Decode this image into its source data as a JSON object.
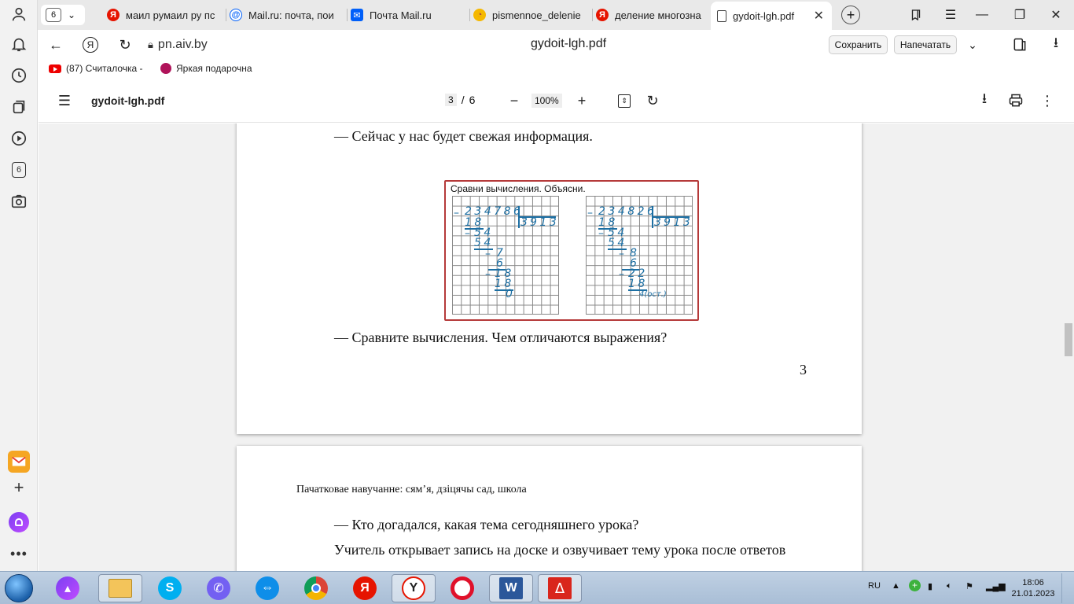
{
  "sidebar": {
    "badge": "6"
  },
  "tabs": {
    "count": "6",
    "items": [
      {
        "label": "маил румаил ру пс",
        "favicon": "yandex",
        "color": "#e61400",
        "glyph": "Я"
      },
      {
        "label": "Mail.ru: почта, пои",
        "favicon": "mailru",
        "color": "#005ff9",
        "glyph": "@"
      },
      {
        "label": "Почта Mail.ru",
        "favicon": "mail-envelope",
        "color": "#005ff9",
        "glyph": "✉"
      },
      {
        "label": "pismennoe_delenie",
        "favicon": "pie",
        "color": "#f0a000",
        "glyph": "◔"
      },
      {
        "label": "деление многозна",
        "favicon": "yandex",
        "color": "#e61400",
        "glyph": "Я"
      },
      {
        "label": "gydoit-lgh.pdf",
        "favicon": "document",
        "color": "#ffffff",
        "glyph": ""
      }
    ]
  },
  "address": {
    "url": "pn.aiv.by",
    "title": "gydoit-lgh.pdf",
    "save_label": "Сохранить",
    "print_label": "Напечатать"
  },
  "bookmarks": [
    {
      "label": "(87) Считалочка -"
    },
    {
      "label": "Яркая подарочна"
    }
  ],
  "pdf": {
    "filename": "gydoit-lgh.pdf",
    "current_page": "3",
    "page_sep": "/",
    "total_pages": "6",
    "zoom": "100%"
  },
  "page3": {
    "line1": "— Сейчас у нас будет свежая информация.",
    "figure_caption": "Сравни вычисления. Объясни.",
    "left_calc": {
      "dividend": "234786",
      "divisor": "3",
      "quotient": "913",
      "steps": [
        "18",
        "54",
        "54",
        "7",
        "6",
        "18",
        "18",
        "0"
      ]
    },
    "right_calc": {
      "dividend": "234826",
      "divisor": "3",
      "quotient": "913",
      "steps": [
        "18",
        "54",
        "54",
        "8",
        "6",
        "22",
        "18",
        "4(ост.)"
      ]
    },
    "line2": "— Сравните вычисления. Чем отличаются выражения?",
    "page_number": "3"
  },
  "page4": {
    "header": "Пачатковае навучанне: сям’я, дзіцячы сад, школа",
    "line1": "— Кто догадался, какая тема сегодняшнего урока?",
    "line2": "Учитель открывает запись на доске и озвучивает тему урока после ответов"
  },
  "taskbar": {
    "language": "RU",
    "time": "18:06",
    "date": "21.01.2023"
  }
}
